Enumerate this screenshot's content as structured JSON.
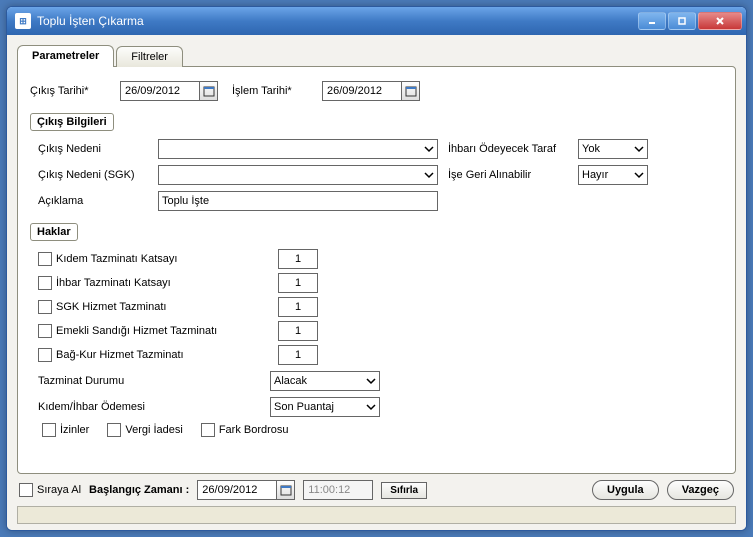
{
  "window": {
    "title": "Toplu İşten Çıkarma"
  },
  "tabs": {
    "parametreler": "Parametreler",
    "filtreler": "Filtreler"
  },
  "dates": {
    "cikis_tarihi_label": "Çıkış Tarihi*",
    "cikis_tarihi_value": "26/09/2012",
    "islem_tarihi_label": "İşlem Tarihi*",
    "islem_tarihi_value": "26/09/2012"
  },
  "cikis_bilgileri": {
    "group_label": "Çıkış Bilgileri",
    "cikis_nedeni_label": "Çıkış Nedeni",
    "cikis_nedeni_value": "",
    "cikis_nedeni_sgk_label": "Çıkış Nedeni (SGK)",
    "cikis_nedeni_sgk_value": "",
    "aciklama_label": "Açıklama",
    "aciklama_value": "Toplu İşte",
    "ihbar_taraf_label": "İhbarı Ödeyecek Taraf",
    "ihbar_taraf_value": "Yok",
    "ise_geri_label": "İşe Geri Alınabilir",
    "ise_geri_value": "Hayır"
  },
  "haklar": {
    "group_label": "Haklar",
    "rows": [
      {
        "label": "Kıdem Tazminatı Katsayı",
        "value": "1"
      },
      {
        "label": "İhbar Tazminatı Katsayı",
        "value": "1"
      },
      {
        "label": "SGK Hizmet Tazminatı",
        "value": "1"
      },
      {
        "label": "Emekli Sandığı Hizmet Tazminatı",
        "value": "1"
      },
      {
        "label": "Bağ-Kur Hizmet Tazminatı",
        "value": "1"
      }
    ],
    "tazminat_durumu_label": "Tazminat Durumu",
    "tazminat_durumu_value": "Alacak",
    "kidem_ihbar_label": "Kıdem/İhbar Ödemesi",
    "kidem_ihbar_value": "Son Puantaj",
    "izinler_label": "İzinler",
    "vergi_iadesi_label": "Vergi İadesi",
    "fark_bordrosu_label": "Fark Bordrosu"
  },
  "bottom": {
    "siraya_al_label": "Sıraya Al",
    "baslangic_label": "Başlangıç Zamanı :",
    "tarih_value": "26/09/2012",
    "saat_value": "11:00:12",
    "sifirla_label": "Sıfırla",
    "uygula_label": "Uygula",
    "vazgec_label": "Vazgeç"
  }
}
